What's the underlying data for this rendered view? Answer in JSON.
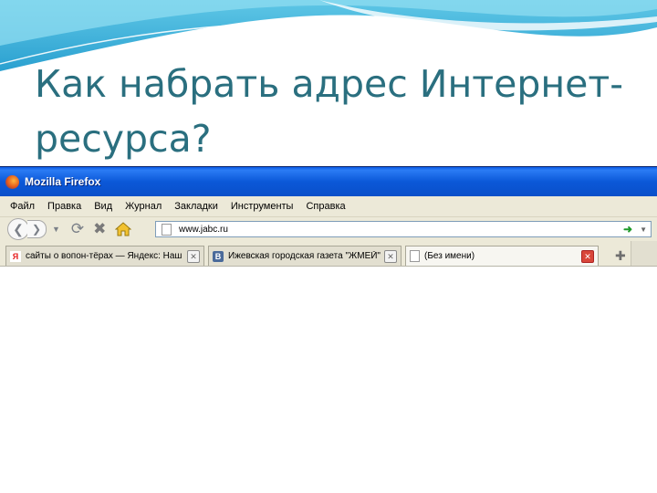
{
  "slide": {
    "title": "Как набрать адрес Интернет-ресурса?"
  },
  "browser": {
    "window_title": "Mozilla Firefox",
    "menu": [
      "Файл",
      "Правка",
      "Вид",
      "Журнал",
      "Закладки",
      "Инструменты",
      "Справка"
    ],
    "url": "www.jabc.ru",
    "tabs": [
      {
        "label": "сайты о вопон-тёрах — Яндекс: Наш ...",
        "icon": "yandex-icon",
        "active": false
      },
      {
        "label": "Ижевская городская газета \"ЖМЕЙ\" ...",
        "icon": "vk-icon",
        "active": false
      },
      {
        "label": "(Без имени)",
        "icon": "blank-page-icon",
        "active": true
      }
    ]
  },
  "colors": {
    "title_color": "#2a6f7f",
    "titlebar_blue": "#0b58d8",
    "chrome_gray": "#ece9d8"
  }
}
